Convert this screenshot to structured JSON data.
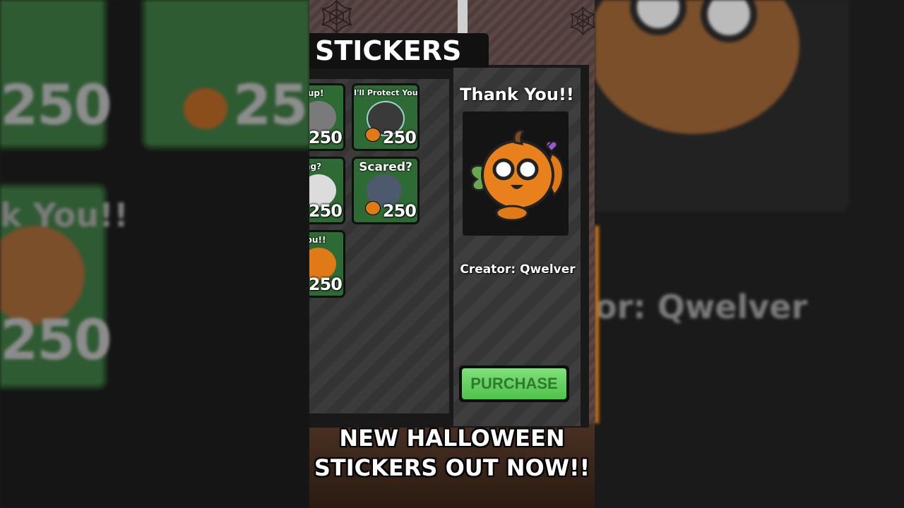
{
  "header": {
    "title": "STICKERS"
  },
  "stickers": [
    {
      "name": "Backup!",
      "price": "250",
      "icon": "cat-sticker-icon"
    },
    {
      "name": "I'll Protect You!",
      "price": "250",
      "icon": "knight-cat-sticker-icon"
    },
    {
      "name": "Anything?",
      "price": "250",
      "icon": "ghost-sticker-icon"
    },
    {
      "name": "Scared?",
      "price": "250",
      "icon": "wolf-sticker-icon"
    },
    {
      "name": "Thank You!!",
      "price": "250",
      "icon": "pumpkin-sticker-icon"
    }
  ],
  "detail": {
    "title": "Thank You!!",
    "creator": "Creator: Qwelver",
    "purchase_label": "PURCHASE"
  },
  "caption": {
    "line1": "NEW HALLOWEEN",
    "line2": "STICKERS OUT NOW!!"
  },
  "background": {
    "price_top_left": "250",
    "price_top_mid": "25",
    "caption_left": "k You!!",
    "price_bottom_left": "250",
    "creator_right": "or: Qwelver"
  },
  "colors": {
    "card_green": "#2e6a33",
    "purchase_green": "#5fd05a",
    "pumpkin_orange": "#e07a16"
  }
}
